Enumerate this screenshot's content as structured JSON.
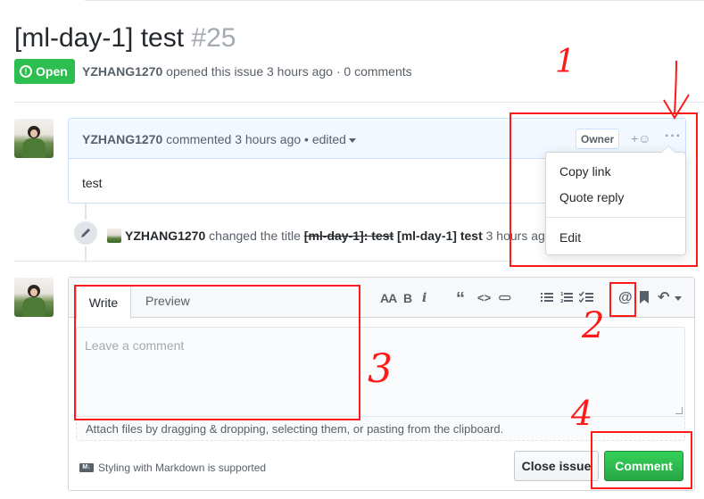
{
  "issue": {
    "title": "[ml-day-1] test",
    "number": "#25",
    "state": "Open",
    "author": "YZHANG1270",
    "meta_rest": "opened this issue 3 hours ago · 0 comments"
  },
  "comment": {
    "author": "YZHANG1270",
    "meta": "commented 3 hours ago • edited",
    "role": "Owner",
    "reaction": "+☺",
    "more": "···",
    "body": "test"
  },
  "menu": {
    "items": [
      "Copy link",
      "Quote reply",
      "Edit"
    ]
  },
  "event": {
    "actor": "YZHANG1270",
    "verb": "changed the title",
    "old_title": "[ml-day-1]:  test",
    "new_title": "[ml-day-1] test",
    "time": "3 hours ago"
  },
  "editor": {
    "tabs": [
      "Write",
      "Preview"
    ],
    "placeholder": "Leave a comment",
    "attach_hint": "Attach files by dragging & dropping, selecting them, or pasting from the clipboard.",
    "markdown_note": "Styling with Markdown is supported",
    "markdown_badge": "M↓",
    "close_button": "Close issue",
    "comment_button": "Comment",
    "toolbar": {
      "header": "AA",
      "bold": "B",
      "italic": "i",
      "quote": "“",
      "code": "<>",
      "link": "⊂⊃",
      "mention": "@",
      "reply": "↶"
    }
  },
  "annotations": {
    "labels": [
      "1",
      "2",
      "3",
      "4"
    ],
    "color": "#ff1a1a"
  }
}
